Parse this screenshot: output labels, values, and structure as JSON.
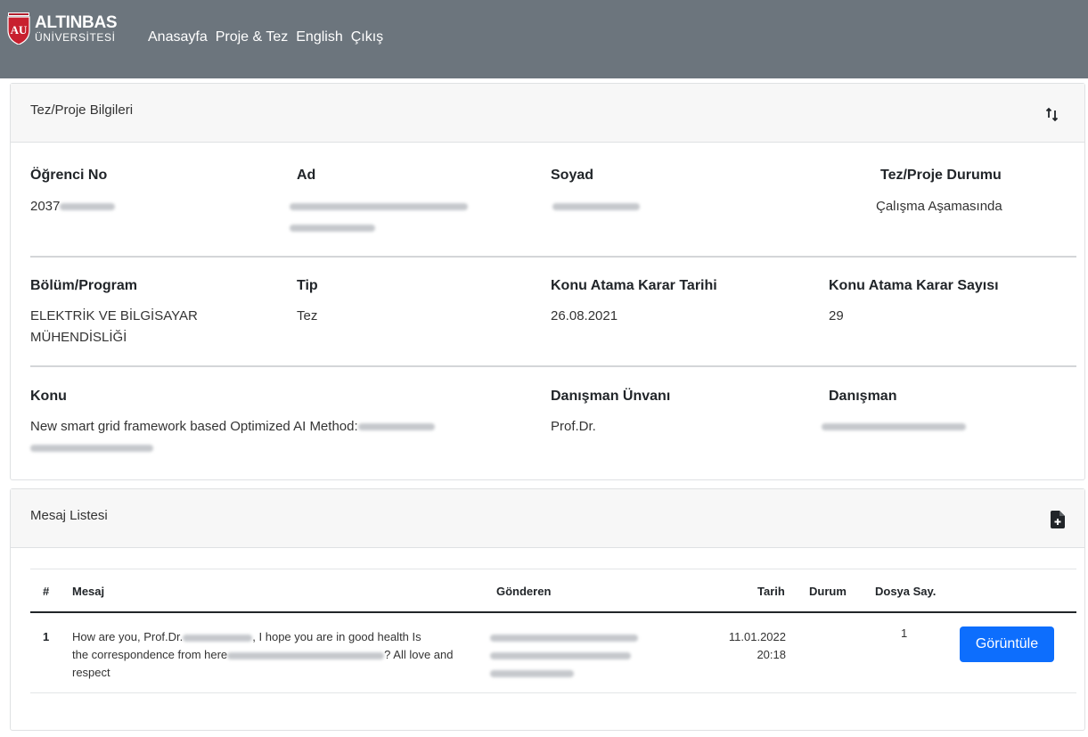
{
  "brand": {
    "name": "ALTINBAS",
    "subtitle": "ÜNİVERSİTESİ",
    "logo_mark": "AU"
  },
  "nav": {
    "items": [
      "Anasayfa",
      "Proje & Tez",
      "English",
      "Çıkış"
    ]
  },
  "thesis_card": {
    "title": "Tez/Proje Bilgileri",
    "icon": "sort-arrows-icon",
    "fields": {
      "student_no": {
        "label": "Öğrenci No",
        "value": "2037"
      },
      "name": {
        "label": "Ad"
      },
      "surname": {
        "label": "Soyad"
      },
      "status": {
        "label": "Tez/Proje Durumu",
        "value": "Çalışma Aşamasında"
      },
      "department": {
        "label": "Bölüm/Program",
        "value_line1": "ELEKTRİK VE BİLGİSAYAR",
        "value_line2": "MÜHENDİSLİĞİ"
      },
      "type": {
        "label": "Tip",
        "value": "Tez"
      },
      "assign_date": {
        "label": "Konu Atama Karar Tarihi",
        "value": "26.08.2021"
      },
      "assign_number": {
        "label": "Konu Atama Karar Sayısı",
        "value": "29"
      },
      "topic": {
        "label": "Konu",
        "value": "New smart grid framework based Optimized AI Method:"
      },
      "advisor_title": {
        "label": "Danışman Ünvanı",
        "value": "Prof.Dr."
      },
      "advisor": {
        "label": "Danışman"
      }
    }
  },
  "message_card": {
    "title": "Mesaj Listesi",
    "icon": "file-plus-icon",
    "columns": [
      "#",
      "Mesaj",
      "Gönderen",
      "Tarih",
      "Durum",
      "Dosya Say."
    ],
    "rows": [
      {
        "index": "1",
        "msg_part1": "How are you, Prof.Dr.",
        "msg_part2": ", I hope you are in good health Is",
        "msg_part3": "the correspondence from here",
        "msg_part4": "? All love and",
        "msg_part5": "respect",
        "date": "11.01.2022",
        "time": "20:18",
        "status": "",
        "file_count": "1",
        "action": "Görüntüle"
      }
    ]
  },
  "colors": {
    "navbar": "#6c757d",
    "primary": "#0d6efd",
    "card_header": "#f7f7f7"
  }
}
